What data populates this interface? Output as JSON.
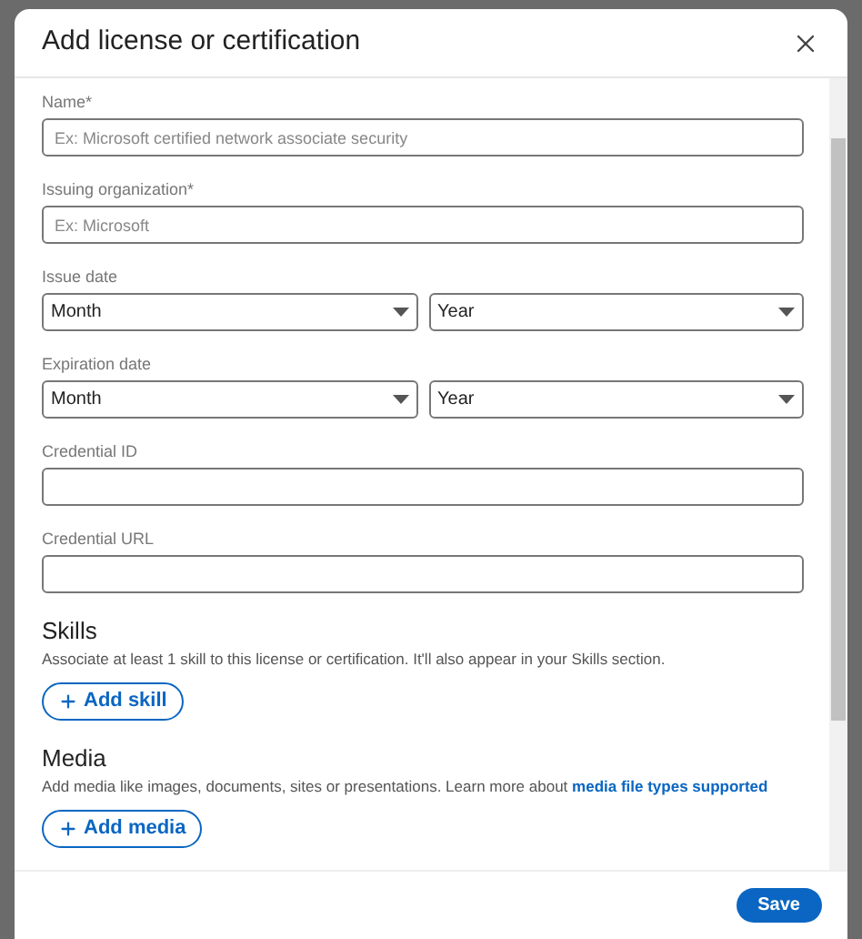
{
  "dialog": {
    "title": "Add license or certification"
  },
  "fields": [
    {
      "kind": "text",
      "label": "Name*",
      "placeholder": "Ex: Microsoft certified network associate security"
    },
    {
      "kind": "text",
      "label": "Issuing organization*",
      "placeholder": "Ex: Microsoft"
    },
    {
      "kind": "date",
      "label": "Issue date",
      "selects": [
        "Month",
        "Year"
      ]
    },
    {
      "kind": "date",
      "label": "Expiration date",
      "selects": [
        "Month",
        "Year"
      ]
    },
    {
      "kind": "text",
      "label": "Credential ID"
    },
    {
      "kind": "text",
      "label": "Credential URL"
    }
  ],
  "sections": [
    {
      "heading": "Skills",
      "description": "Associate at least 1 skill to this license or certification. It'll also appear in your Skills section.",
      "button": "Add skill"
    },
    {
      "heading": "Media",
      "description": "Add media like images, documents, sites or presentations. Learn more about",
      "link": "media file types supported",
      "button": "Add media"
    }
  ],
  "footer": {
    "button": "Save"
  }
}
